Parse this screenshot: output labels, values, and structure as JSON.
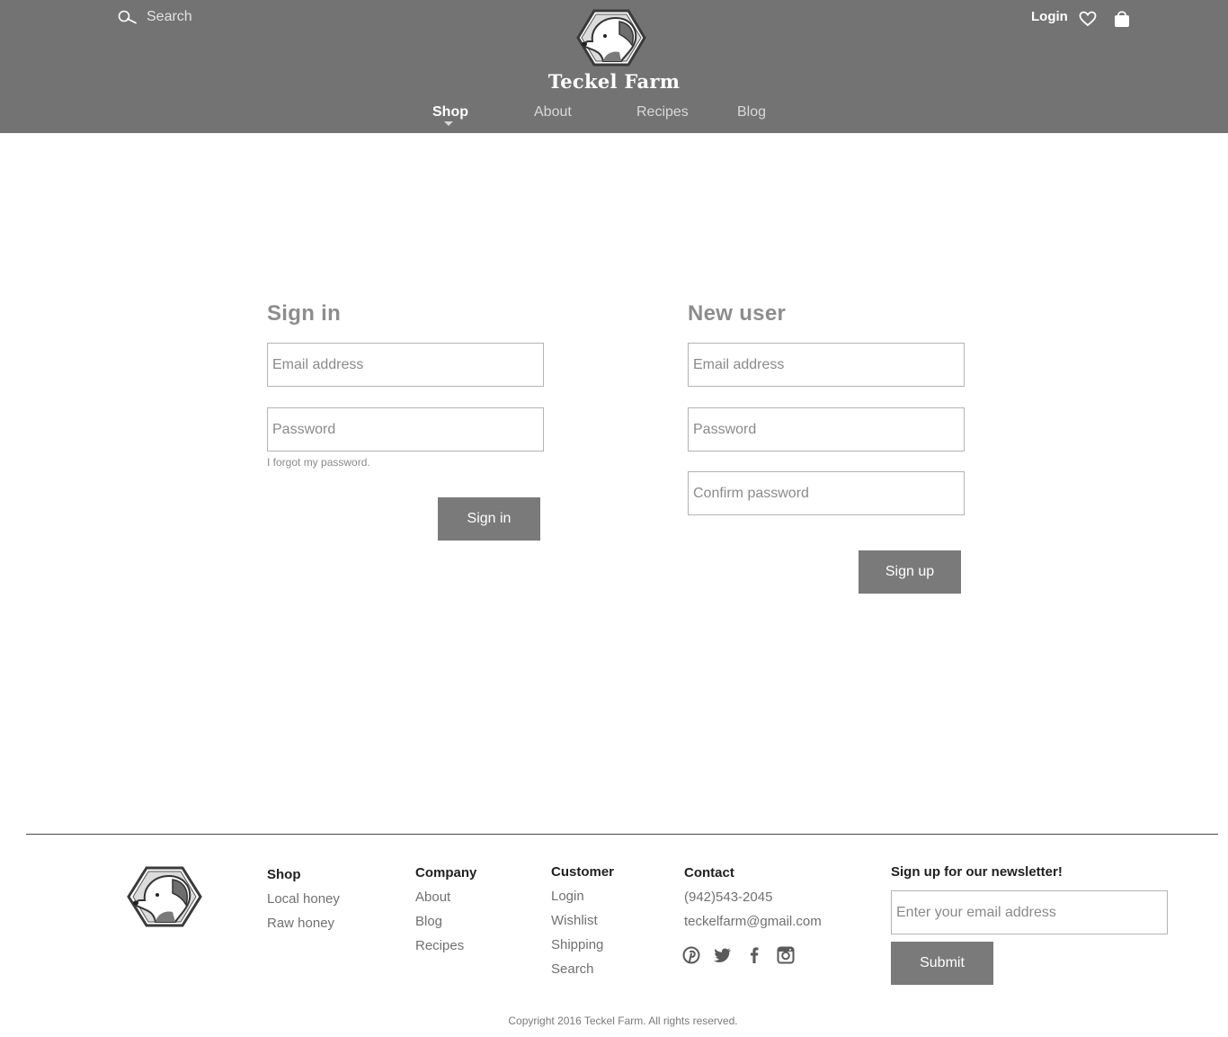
{
  "header": {
    "search_label": "Search",
    "brand_name": "Teckel Farm",
    "login_label": "Login",
    "nav": [
      "Shop",
      "About",
      "Recipes",
      "Blog"
    ],
    "active_nav": "Shop"
  },
  "signin": {
    "title": "Sign in",
    "email_placeholder": "Email address",
    "password_placeholder": "Password",
    "forgot_label": "I forgot my password.",
    "button_label": "Sign in"
  },
  "signup": {
    "title": "New user",
    "email_placeholder": "Email address",
    "password_placeholder": "Password",
    "confirm_placeholder": "Confirm password",
    "button_label": "Sign up"
  },
  "footer": {
    "shop": {
      "title": "Shop",
      "links": [
        "Local honey",
        "Raw honey"
      ]
    },
    "company": {
      "title": "Company",
      "links": [
        "About",
        "Blog",
        "Recipes"
      ]
    },
    "customer": {
      "title": "Customer",
      "links": [
        "Login",
        "Wishlist",
        "Shipping",
        "Search"
      ]
    },
    "contact": {
      "title": "Contact",
      "phone": "(942)543-2045",
      "email": "teckelfarm@gmail.com",
      "social": [
        "pinterest-icon",
        "twitter-icon",
        "facebook-icon",
        "instagram-icon"
      ]
    },
    "newsletter": {
      "title": "Sign up for our newsletter!",
      "placeholder": "Enter your email address",
      "button_label": "Submit"
    },
    "copyright": "Copyright 2016 Teckel Farm. All rights reserved."
  },
  "colors": {
    "header_bg": "#737373",
    "button_bg": "#7a7a7a",
    "title_gray": "#8d8d8d"
  }
}
